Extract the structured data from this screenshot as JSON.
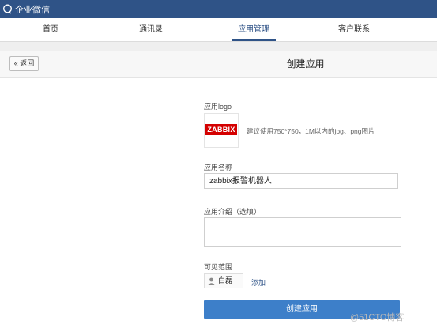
{
  "app": {
    "brand_title": "企业微信",
    "brand_icon": "chat-bubble-icon",
    "topbar_color": "#2f5387"
  },
  "nav": {
    "tabs": [
      {
        "label": "首页",
        "active": false
      },
      {
        "label": "通讯录",
        "active": false
      },
      {
        "label": "应用管理",
        "active": true
      },
      {
        "label": "客户联系",
        "active": false,
        "icon": "wechat-icon"
      }
    ]
  },
  "header": {
    "back_label": "« 返回",
    "page_title": "创建应用"
  },
  "form": {
    "logo_label": "应用logo",
    "logo_text": "ZABBIX",
    "logo_hint": "建议使用750*750，1M以内的jpg、png图片",
    "name_label": "应用名称",
    "name_value": "zabbix报警机器人",
    "intro_label": "应用介绍（选填）",
    "intro_value": "",
    "scope_label": "可见范围",
    "scope_member": "白磊",
    "scope_add": "添加",
    "submit_label": "创建应用",
    "accent_color": "#3d7fc9"
  },
  "watermark": "@51CTO博客"
}
